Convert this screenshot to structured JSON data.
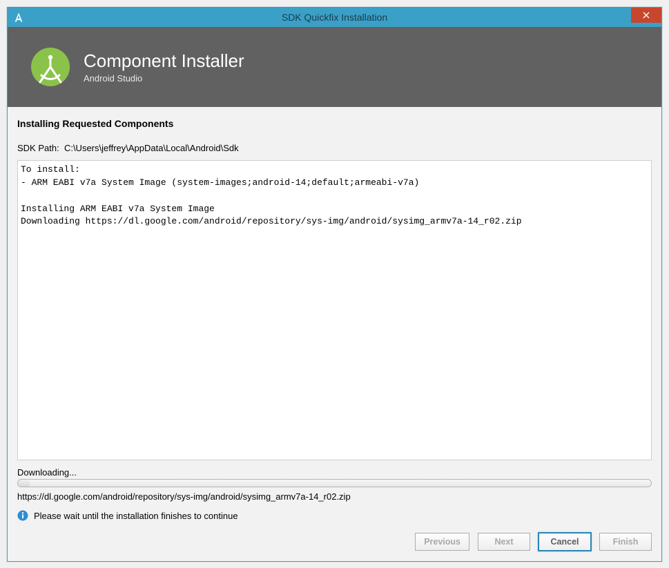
{
  "titlebar": {
    "title": "SDK Quickfix Installation"
  },
  "header": {
    "heading": "Component Installer",
    "subheading": "Android Studio"
  },
  "content": {
    "sectionTitle": "Installing Requested Components",
    "sdkPathLabel": "SDK Path:",
    "sdkPath": "C:\\Users\\jeffrey\\AppData\\Local\\Android\\Sdk",
    "logText": "To install:\n- ARM EABI v7a System Image (system-images;android-14;default;armeabi-v7a)\n\nInstalling ARM EABI v7a System Image\nDownloading https://dl.google.com/android/repository/sys-img/android/sysimg_armv7a-14_r02.zip",
    "statusLabel": "Downloading...",
    "progressPercent": 2,
    "currentUrl": "https://dl.google.com/android/repository/sys-img/android/sysimg_armv7a-14_r02.zip",
    "waitMessage": "Please wait until the installation finishes to continue"
  },
  "buttons": {
    "previous": "Previous",
    "next": "Next",
    "cancel": "Cancel",
    "finish": "Finish"
  }
}
